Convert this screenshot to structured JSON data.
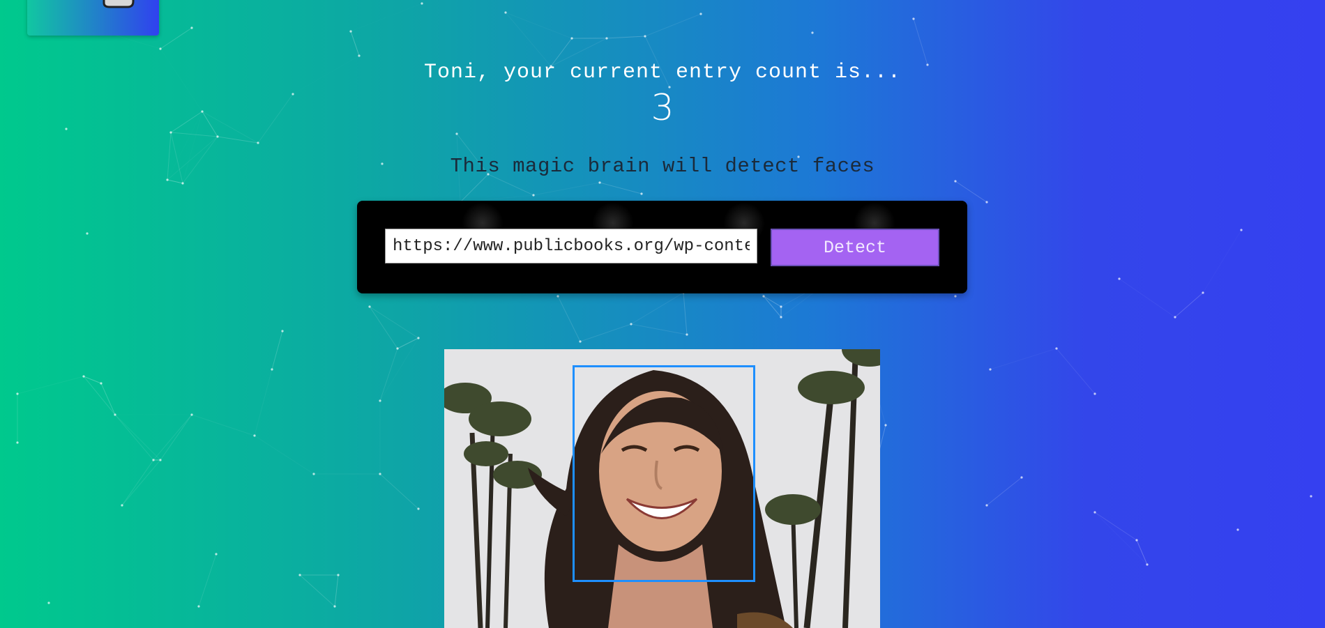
{
  "app": {
    "greeting": "Toni, your current entry count is...",
    "entry_count": "3",
    "tagline": "This magic brain will detect faces"
  },
  "form": {
    "url_value": "https://www.publicbooks.org/wp-content",
    "detect_label": "Detect"
  },
  "icons": {
    "logo": "brain-logo-icon"
  },
  "colors": {
    "gradient_start": "#00c98d",
    "gradient_end": "#3540f0",
    "button": "#a463f2",
    "bounding_box": "#1e8fff"
  }
}
